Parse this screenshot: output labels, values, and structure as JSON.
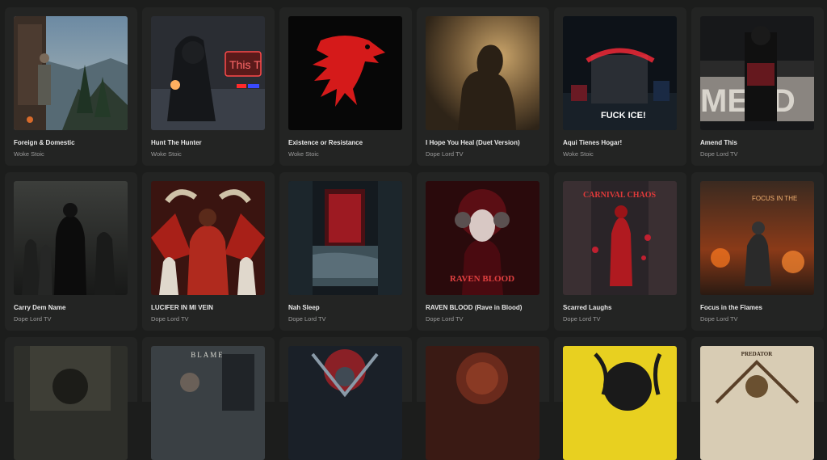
{
  "albums": [
    {
      "title": "Foreign & Domestic",
      "artist": "Woke Stoic"
    },
    {
      "title": "Hunt The Hunter",
      "artist": "Woke Stoic",
      "art_text": "This T"
    },
    {
      "title": "Existence or Resistance",
      "artist": "Woke Stoic"
    },
    {
      "title": "I Hope You Heal (Duet Version)",
      "artist": "Dope Lord TV"
    },
    {
      "title": "Aqui Tienes Hogar!",
      "artist": "Woke Stoic",
      "art_text": "FUCK ICE!"
    },
    {
      "title": "Amend This",
      "artist": "Dope Lord TV",
      "art_text": "MEND"
    },
    {
      "title": "Carry Dem Name",
      "artist": "Dope Lord TV"
    },
    {
      "title": "LUCIFER IN MI VEIN",
      "artist": "Dope Lord TV"
    },
    {
      "title": "Nah Sleep",
      "artist": "Dope Lord TV"
    },
    {
      "title": "RAVEN BLOOD (Rave in Blood)",
      "artist": "Dope Lord TV",
      "art_text": "RAVEN BLOOD"
    },
    {
      "title": "Scarred Laughs",
      "artist": "Dope Lord TV",
      "art_text": "CARNIVAL CHAOS"
    },
    {
      "title": "Focus in the Flames",
      "artist": "Dope Lord TV",
      "art_text": "FOCUS IN THE"
    }
  ],
  "partial_row_art_text": [
    "",
    "BLAME",
    "",
    "",
    "",
    "PREDATOR"
  ]
}
